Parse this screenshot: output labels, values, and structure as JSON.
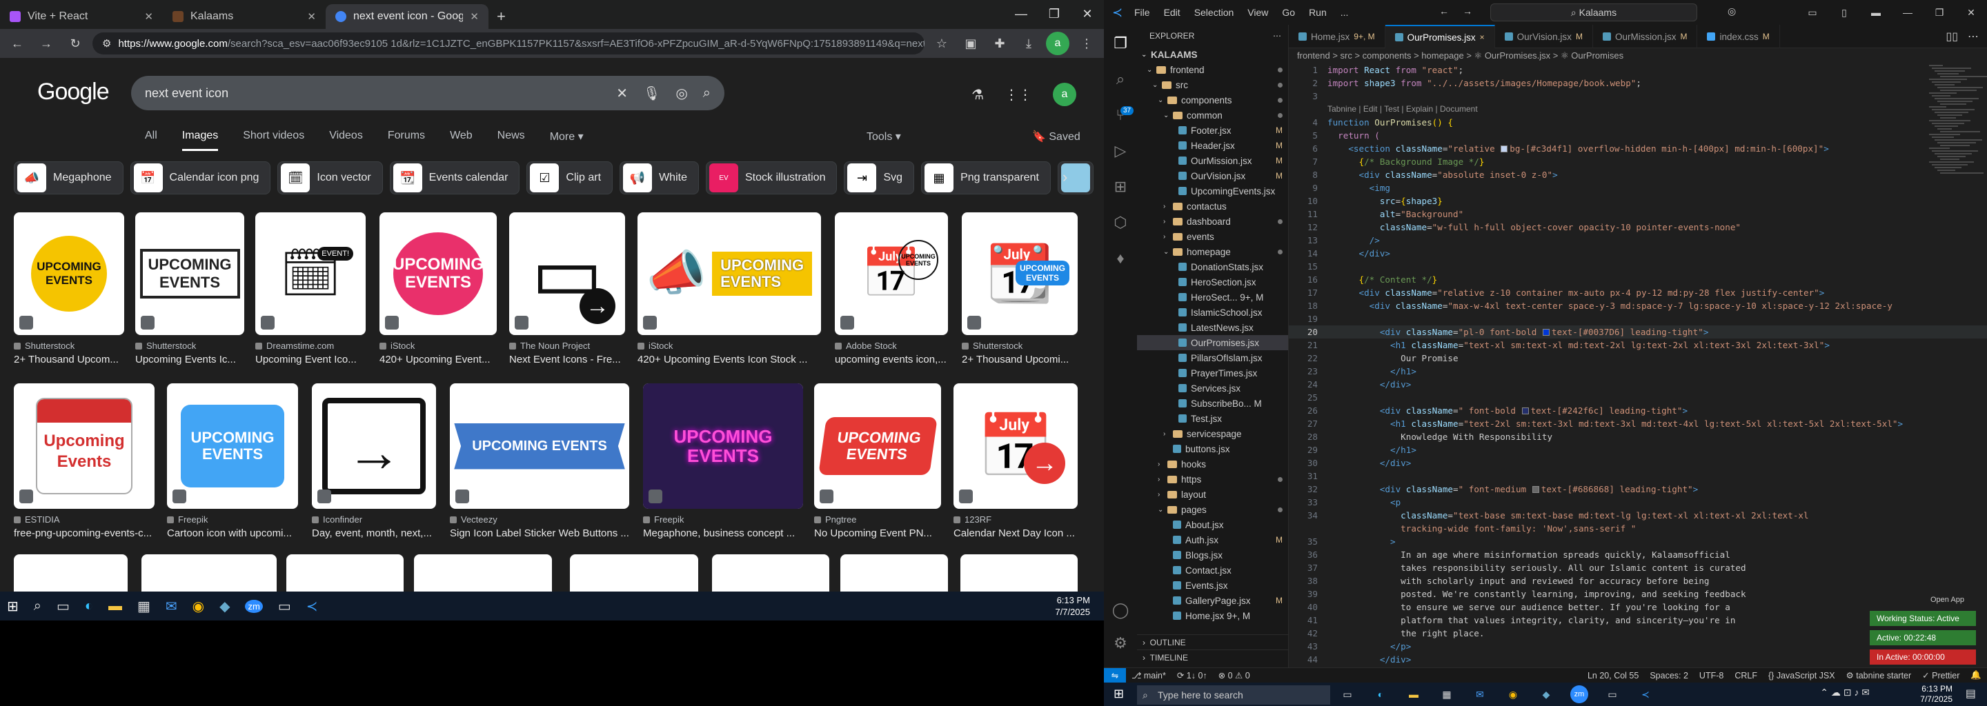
{
  "chrome": {
    "tabs": [
      {
        "title": "Vite + React",
        "icon_color": "#a855f7",
        "active": false
      },
      {
        "title": "Kalaams",
        "icon_color": "#6b4226",
        "active": false
      },
      {
        "title": "next event icon - Google Searc",
        "icon_color": "#4285f4",
        "active": true
      }
    ],
    "new_tab": "+",
    "url_host": "https://www.google.com",
    "url_rest": "/search?sca_esv=aac06f93ec9105 1d&rlz=1C1JZTC_enGBPK1157PK1157&sxsrf=AE3TifO6-xPFZpcuGIM_aR-d-5YqW6FNpQ:1751893891149&q=next+event+icon&udm...",
    "avatar_letter": "a"
  },
  "google": {
    "logo": "Google",
    "query": "next event icon",
    "nav": [
      "All",
      "Images",
      "Short videos",
      "Videos",
      "Forums",
      "Web",
      "News",
      "More ▾"
    ],
    "tools": "Tools ▾",
    "saved": "Saved",
    "chips": [
      "Megaphone",
      "Calendar icon png",
      "Icon vector",
      "Events calendar",
      "Clip art",
      "White",
      "Stock illustration",
      "Svg",
      "Png transparent"
    ],
    "row1": [
      {
        "source": "Shutterstock",
        "caption": "2+ Thousand Upcom...",
        "text": "UPCOMING EVENTS",
        "style": "yellow"
      },
      {
        "source": "Shutterstock",
        "caption": "Upcoming Events Ic...",
        "text": "UPCOMING EVENTS",
        "style": "outline"
      },
      {
        "source": "Dreamstime.com",
        "caption": "Upcoming Event Ico...",
        "text": "EVENT!",
        "style": "calendar"
      },
      {
        "source": "iStock",
        "caption": "420+ Upcoming Event...",
        "text": "UPCOMING EVENTS",
        "style": "pink"
      },
      {
        "source": "The Noun Project",
        "caption": "Next Event Icons - Fre...",
        "text": "→",
        "style": "cal-arrow"
      },
      {
        "source": "iStock",
        "caption": "420+ Upcoming Events Icon Stock ...",
        "text": "UPCOMING EVENTS",
        "style": "megaphone"
      },
      {
        "source": "Adobe Stock",
        "caption": "upcoming events icon,...",
        "text": "UPCOMING EVENTS",
        "style": "calendar2"
      },
      {
        "source": "Shutterstock",
        "caption": "2+ Thousand Upcomi...",
        "text": "UPCOMING EVENTS",
        "style": "blue-cal"
      }
    ],
    "row2": [
      {
        "source": "ESTIDIA",
        "caption": "free-png-upcoming-events-c...",
        "text": "Upcoming Events",
        "style": "red-cal"
      },
      {
        "source": "Freepik",
        "caption": "Cartoon icon with upcomi...",
        "text": "UPCOMING EVENTS",
        "style": "blue-bubble"
      },
      {
        "source": "Iconfinder",
        "caption": "Day, event, month, next,...",
        "text": "→",
        "style": "cal-arrow2"
      },
      {
        "source": "Vecteezy",
        "caption": "Sign Icon Label Sticker Web Buttons ...",
        "text": "UPCOMING EVENTS",
        "style": "blue-label"
      },
      {
        "source": "Freepik",
        "caption": "Megaphone, business concept ...",
        "text": "UPCOMING EVENTS",
        "style": "neon"
      },
      {
        "source": "Pngtree",
        "caption": "No Upcoming Event PN...",
        "text": "UPCOMING EVENTS",
        "style": "red-label"
      },
      {
        "source": "123RF",
        "caption": "Calendar Next Day Icon ...",
        "text": "→",
        "style": "orange-cal"
      }
    ]
  },
  "taskbar_left": {
    "time": "6:13 PM",
    "date": "7/7/2025"
  },
  "vscode": {
    "menu": [
      "File",
      "Edit",
      "Selection",
      "View",
      "Go",
      "Run",
      "..."
    ],
    "command_center": "Kalaams",
    "explorer_title": "EXPLORER",
    "root": "KALAAMS",
    "tree": [
      {
        "name": "frontend",
        "depth": 1,
        "type": "folder",
        "open": true,
        "status": "dot"
      },
      {
        "name": "src",
        "depth": 2,
        "type": "folder",
        "open": true,
        "status": "dot"
      },
      {
        "name": "components",
        "depth": 3,
        "type": "folder",
        "open": true,
        "status": "dot"
      },
      {
        "name": "common",
        "depth": 4,
        "type": "folder",
        "open": true,
        "status": "dot"
      },
      {
        "name": "Footer.jsx",
        "depth": 5,
        "type": "file",
        "status": "M"
      },
      {
        "name": "Header.jsx",
        "depth": 5,
        "type": "file",
        "status": "M"
      },
      {
        "name": "OurMission.jsx",
        "depth": 5,
        "type": "file",
        "status": "M"
      },
      {
        "name": "OurVision.jsx",
        "depth": 5,
        "type": "file",
        "status": "M"
      },
      {
        "name": "UpcomingEvents.jsx",
        "depth": 5,
        "type": "file",
        "status": ""
      },
      {
        "name": "contactus",
        "depth": 4,
        "type": "folder",
        "open": false,
        "status": ""
      },
      {
        "name": "dashboard",
        "depth": 4,
        "type": "folder",
        "open": false,
        "status": "dot"
      },
      {
        "name": "events",
        "depth": 4,
        "type": "folder",
        "open": false,
        "status": ""
      },
      {
        "name": "homepage",
        "depth": 4,
        "type": "folder",
        "open": true,
        "status": "dot"
      },
      {
        "name": "DonationStats.jsx",
        "depth": 5,
        "type": "file",
        "status": ""
      },
      {
        "name": "HeroSection.jsx",
        "depth": 5,
        "type": "file",
        "status": ""
      },
      {
        "name": "HeroSect... 9+, M",
        "depth": 5,
        "type": "file",
        "status": ""
      },
      {
        "name": "IslamicSchool.jsx",
        "depth": 5,
        "type": "file",
        "status": ""
      },
      {
        "name": "LatestNews.jsx",
        "depth": 5,
        "type": "file",
        "status": ""
      },
      {
        "name": "OurPromises.jsx",
        "depth": 5,
        "type": "file",
        "status": "",
        "selected": true
      },
      {
        "name": "PillarsOfIslam.jsx",
        "depth": 5,
        "type": "file",
        "status": ""
      },
      {
        "name": "PrayerTimes.jsx",
        "depth": 5,
        "type": "file",
        "status": ""
      },
      {
        "name": "Services.jsx",
        "depth": 5,
        "type": "file",
        "status": ""
      },
      {
        "name": "SubscribeBo... M",
        "depth": 5,
        "type": "file",
        "status": ""
      },
      {
        "name": "Test.jsx",
        "depth": 5,
        "type": "file",
        "status": ""
      },
      {
        "name": "servicespage",
        "depth": 4,
        "type": "folder",
        "open": false,
        "status": ""
      },
      {
        "name": "buttons.jsx",
        "depth": 4,
        "type": "file",
        "status": ""
      },
      {
        "name": "hooks",
        "depth": 3,
        "type": "folder",
        "open": false,
        "status": ""
      },
      {
        "name": "https",
        "depth": 3,
        "type": "folder",
        "open": false,
        "status": "dot"
      },
      {
        "name": "layout",
        "depth": 3,
        "type": "folder",
        "open": false,
        "status": ""
      },
      {
        "name": "pages",
        "depth": 3,
        "type": "folder",
        "open": true,
        "status": "dot"
      },
      {
        "name": "About.jsx",
        "depth": 4,
        "type": "file",
        "status": ""
      },
      {
        "name": "Auth.jsx",
        "depth": 4,
        "type": "file",
        "status": "M"
      },
      {
        "name": "Blogs.jsx",
        "depth": 4,
        "type": "file",
        "status": ""
      },
      {
        "name": "Contact.jsx",
        "depth": 4,
        "type": "file",
        "status": ""
      },
      {
        "name": "Events.jsx",
        "depth": 4,
        "type": "file",
        "status": ""
      },
      {
        "name": "GalleryPage.jsx",
        "depth": 4,
        "type": "file",
        "status": "M"
      },
      {
        "name": "Home.jsx 9+, M",
        "depth": 4,
        "type": "file",
        "status": ""
      }
    ],
    "outline": "OUTLINE",
    "timeline": "TIMELINE",
    "tabs": [
      {
        "name": "Home.jsx",
        "status": "9+, M",
        "active": false
      },
      {
        "name": "OurPromises.jsx",
        "status": "×",
        "active": true
      },
      {
        "name": "OurVision.jsx",
        "status": "M",
        "active": false
      },
      {
        "name": "OurMission.jsx",
        "status": "M",
        "active": false
      },
      {
        "name": "index.css",
        "status": "M",
        "active": false
      }
    ],
    "breadcrumb": "frontend > src > components > homepage > ⚛ OurPromises.jsx > ⚛ OurPromises",
    "codelens": "Tabnine | Edit | Test | Explain | Document",
    "status_left": [
      "⎇ main*",
      "⟳ 1↓ 0↑",
      "⊗ 0 ⚠ 0"
    ],
    "status_right": [
      "Ln 20, Col 55",
      "Spaces: 2",
      "UTF-8",
      "CRLF",
      "{} JavaScript JSX",
      "⚙ tabnine starter",
      "✓ Prettier"
    ],
    "open_app": "Open App",
    "working_status": "Working Status: Active",
    "active_time": "Active: 00:22:48",
    "inactive_time": "In Active: 00:00:00"
  },
  "taskbar_right": {
    "search": "Type here to search",
    "time": "6:13 PM",
    "date": "7/7/2025"
  }
}
